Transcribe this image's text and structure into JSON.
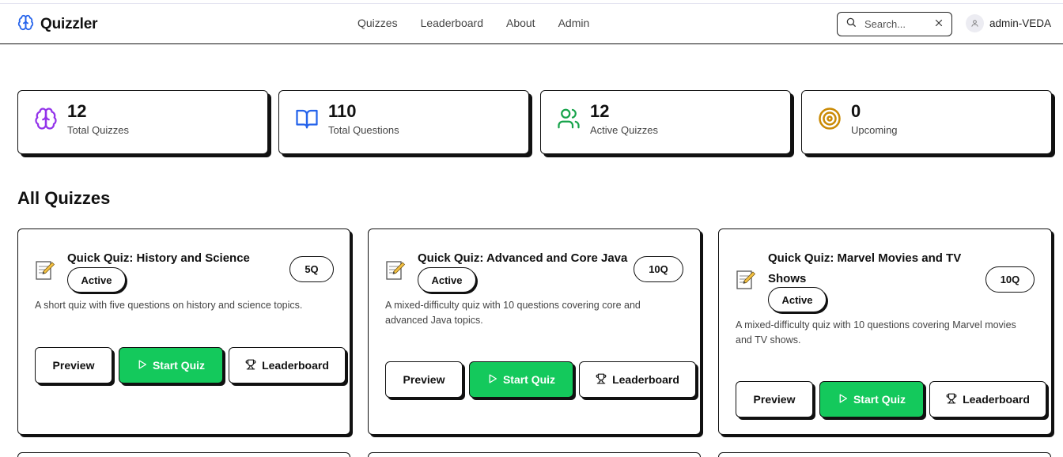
{
  "app": {
    "title": "Quizzler"
  },
  "nav": {
    "items": [
      "Quizzes",
      "Leaderboard",
      "About",
      "Admin"
    ]
  },
  "search": {
    "placeholder": "Search..."
  },
  "user": {
    "name": "admin-VEDA"
  },
  "stats": [
    {
      "value": "12",
      "label": "Total Quizzes",
      "icon": "brain-icon",
      "color": "#9333ea"
    },
    {
      "value": "110",
      "label": "Total Questions",
      "icon": "book-open-icon",
      "color": "#2563eb"
    },
    {
      "value": "12",
      "label": "Active Quizzes",
      "icon": "users-icon",
      "color": "#16a34a"
    },
    {
      "value": "0",
      "label": "Upcoming",
      "icon": "target-icon",
      "color": "#ca8a04"
    }
  ],
  "section": {
    "title": "All Quizzes"
  },
  "quizzes": [
    {
      "title": "Quick Quiz: History and Science",
      "status": "Active",
      "count": "5Q",
      "description": "A short quiz with five questions on history and science topics.",
      "buttons": {
        "preview": "Preview",
        "start": "Start Quiz",
        "leaderboard": "Leaderboard"
      }
    },
    {
      "title": "Quick Quiz: Advanced and Core Java",
      "status": "Active",
      "count": "10Q",
      "description": "A mixed-difficulty quiz with 10 questions covering core and advanced Java topics.",
      "buttons": {
        "preview": "Preview",
        "start": "Start Quiz",
        "leaderboard": "Leaderboard"
      }
    },
    {
      "title": "Quick Quiz: Marvel Movies and TV Shows",
      "status": "Active",
      "count": "10Q",
      "description": "A mixed-difficulty quiz with 10 questions covering Marvel movies and TV shows.",
      "buttons": {
        "preview": "Preview",
        "start": "Start Quiz",
        "leaderboard": "Leaderboard"
      }
    }
  ],
  "colors": {
    "accent_green": "#14c95c",
    "border": "#111111"
  }
}
